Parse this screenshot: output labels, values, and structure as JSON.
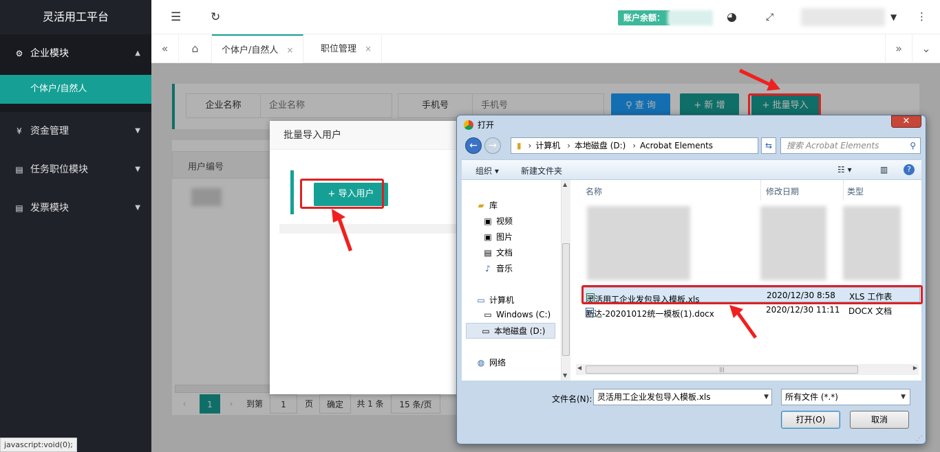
{
  "sidebar": {
    "brand": "灵活用工平台",
    "menu": [
      {
        "label": "企业模块",
        "icon": "⚙",
        "caret": "▲"
      },
      {
        "label": "资金管理",
        "icon": "¥",
        "caret": "▼"
      },
      {
        "label": "任务职位模块",
        "icon": "▤",
        "caret": "▼"
      },
      {
        "label": "发票模块",
        "icon": "▤",
        "caret": "▼"
      }
    ],
    "active_sub": "个体户/自然人"
  },
  "header": {
    "balance_label": "账户余额：",
    "icons": [
      "menu-icon",
      "refresh-icon",
      "palette-icon",
      "fullscreen-icon",
      "more-icon"
    ]
  },
  "tabs": {
    "items": [
      {
        "label": "个体户/自然人",
        "close": "×"
      },
      {
        "label": "职位管理",
        "close": "×"
      }
    ]
  },
  "search": {
    "company_label": "企业名称",
    "company_placeholder": "企业名称",
    "phone_label": "手机号",
    "phone_placeholder": "手机号",
    "query_button": "查 询",
    "add_button": "+ 新 增",
    "batch_import_button": "+ 批量导入"
  },
  "table": {
    "col_user_id": "用户编号"
  },
  "pager": {
    "current": "1",
    "goto_label": "到第",
    "goto_value": "1",
    "page_label": "页",
    "confirm": "确定",
    "total": "共 1 条",
    "per_page": "15 条/页"
  },
  "modal": {
    "title": "批量导入用户",
    "import_button": "+ 导入用户"
  },
  "dialog": {
    "title": "打开",
    "close": "✕",
    "path": [
      "计算机",
      "本地磁盘 (D:)",
      "Acrobat Elements"
    ],
    "search_placeholder": "搜索 Acrobat Elements",
    "organize": "组织 ▾",
    "new_folder": "新建文件夹",
    "nav": [
      {
        "label": "库",
        "icon": "📁",
        "indent": 0
      },
      {
        "label": "视频",
        "icon": "▣",
        "indent": 1
      },
      {
        "label": "图片",
        "icon": "▣",
        "indent": 1
      },
      {
        "label": "文档",
        "icon": "▣",
        "indent": 1
      },
      {
        "label": "音乐",
        "icon": "♪",
        "indent": 1
      },
      {
        "label": "计算机",
        "icon": "▭",
        "indent": 0
      },
      {
        "label": "Windows (C:)",
        "icon": "▭",
        "indent": 1
      },
      {
        "label": "本地磁盘 (D:)",
        "icon": "▭",
        "indent": 1
      },
      {
        "label": "网络",
        "icon": "◍",
        "indent": 0
      }
    ],
    "columns": {
      "name": "名称",
      "date": "修改日期",
      "type": "类型"
    },
    "files": [
      {
        "name": "灵活用工企业发包导入模板.xls",
        "date": "2020/12/30 8:58",
        "type": "XLS 工作表",
        "icon": "x"
      },
      {
        "name": "新达-20201012统一模板(1).docx",
        "date": "2020/12/30 11:11",
        "type": "DOCX 文档",
        "icon": "W"
      }
    ],
    "filename_label": "文件名(N):",
    "filename_value": "灵活用工企业发包导入模板.xls",
    "filetype_value": "所有文件 (*.*)",
    "open_button": "打开(O)",
    "cancel_button": "取消"
  },
  "statusbar": "javascript:void(0);",
  "colors": {
    "accent": "#16a095",
    "highlight": "#e02020",
    "query": "#1e9fff"
  }
}
